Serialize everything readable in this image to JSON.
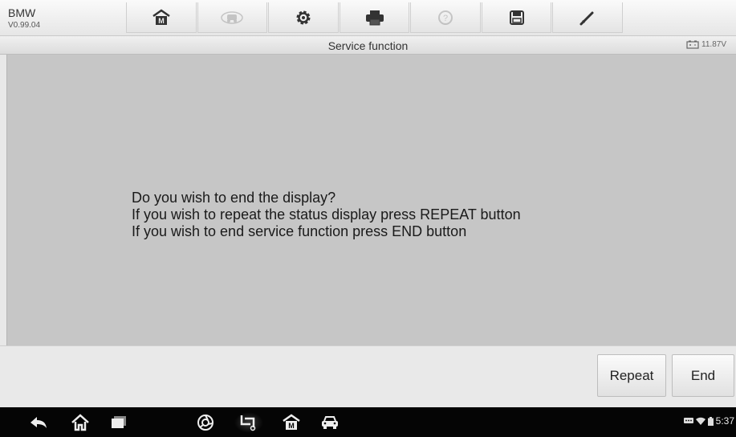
{
  "app": {
    "name": "BMW",
    "version": "V0.99.04"
  },
  "toolbar": {
    "items": [
      {
        "icon": "home-icon",
        "enabled": true
      },
      {
        "icon": "vehicle-swap-icon",
        "enabled": false
      },
      {
        "icon": "settings-gear-icon",
        "enabled": true
      },
      {
        "icon": "printer-icon",
        "enabled": true
      },
      {
        "icon": "help-icon",
        "enabled": false
      },
      {
        "icon": "save-icon",
        "enabled": true
      },
      {
        "icon": "pen-icon",
        "enabled": true
      }
    ]
  },
  "titlebar": {
    "title": "Service function",
    "battery_voltage": "11.87V"
  },
  "main": {
    "message_lines": [
      "Do you wish to end the display?",
      "If you wish to repeat the status display press REPEAT button",
      "If you wish to end service function press END button"
    ]
  },
  "actions": {
    "repeat_label": "Repeat",
    "end_label": "End"
  },
  "navbar": {
    "icons": [
      "back-icon",
      "home-icon",
      "recent-apps-icon",
      "browser-icon",
      "screenshot-icon",
      "maxi-home-icon",
      "car-icon"
    ],
    "clock": "5:37"
  },
  "colors": {
    "panel": "#c6c6c6",
    "navbar": "#050505",
    "toolbar": "#ececec"
  }
}
